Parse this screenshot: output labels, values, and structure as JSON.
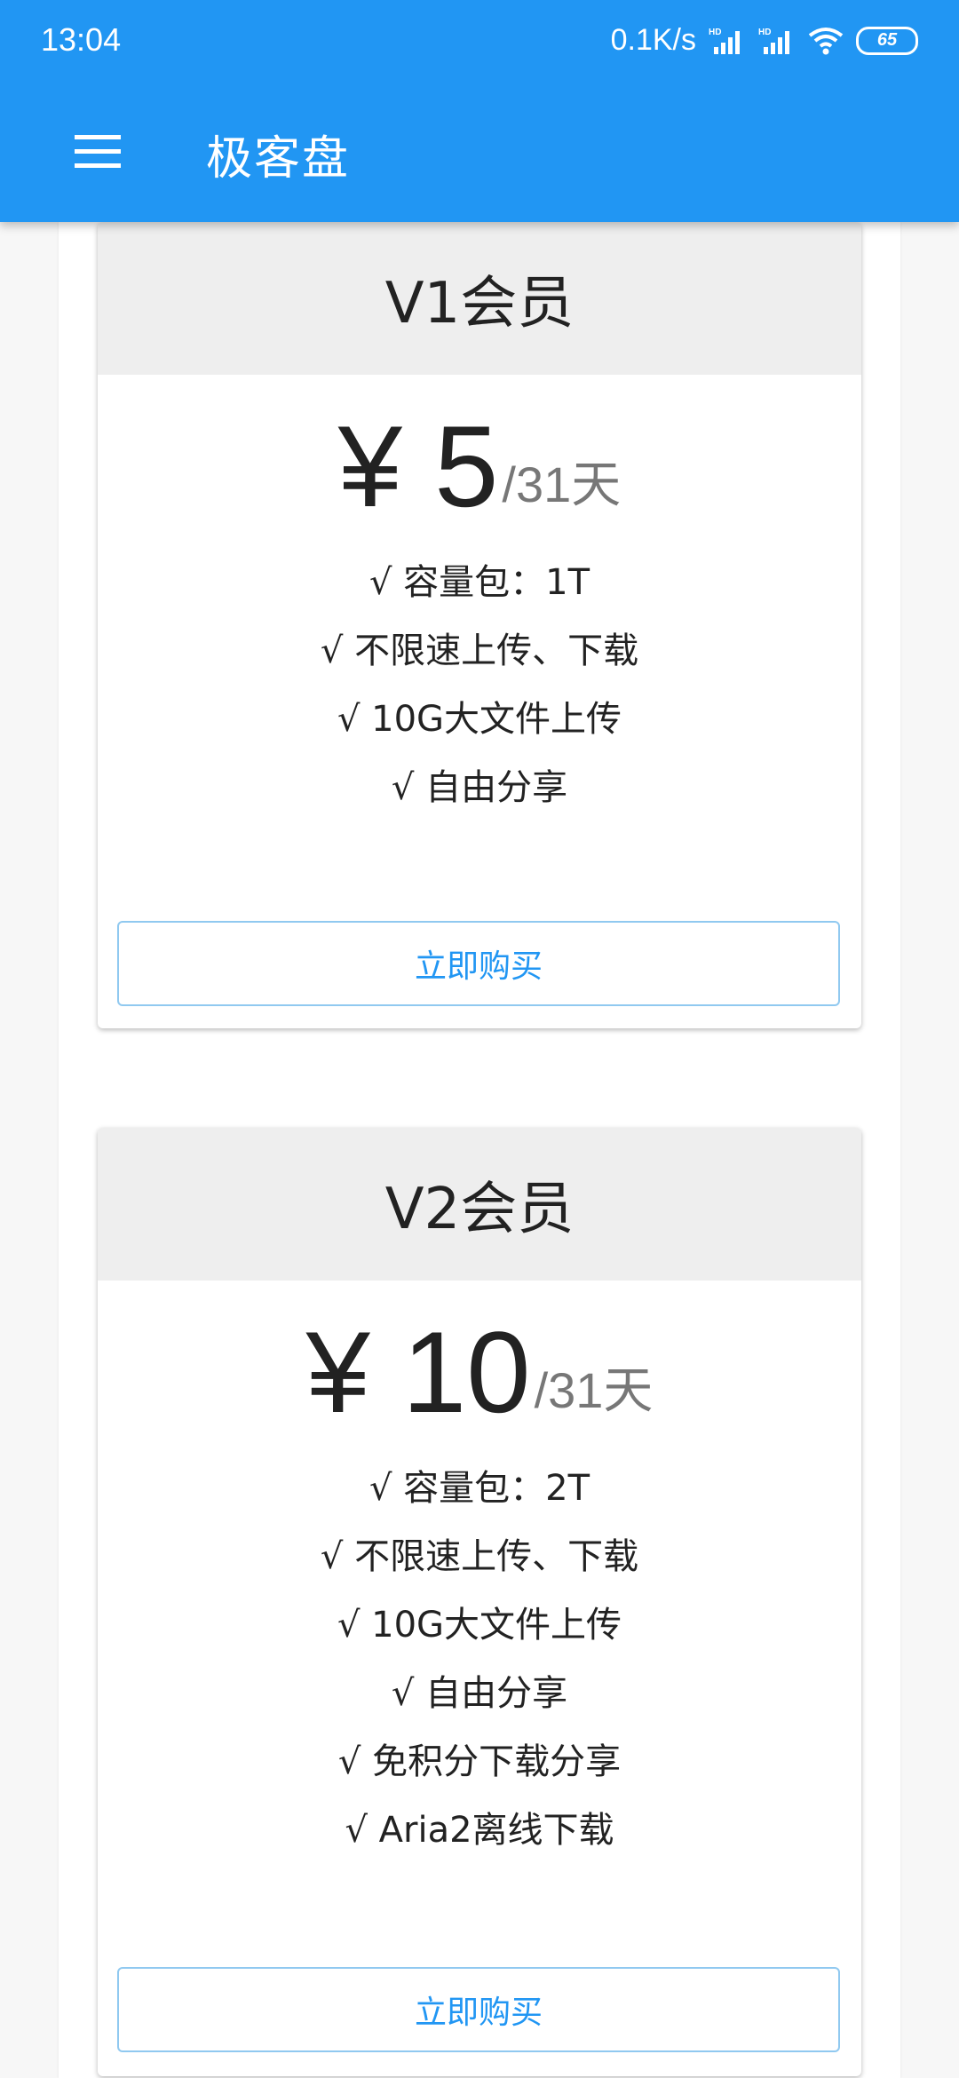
{
  "status_bar": {
    "time": "13:04",
    "net_speed": "0.1K/s",
    "battery": "65",
    "icons": [
      "hd-signal-icon",
      "hd-signal-icon",
      "wifi-icon",
      "battery-icon"
    ]
  },
  "toolbar": {
    "title": "极客盘",
    "menu_icon": "hamburger-menu-icon"
  },
  "colors": {
    "app_bar": "#2196f3",
    "accent": "#2196f3",
    "card_header": "#eeeeee"
  },
  "plans": [
    {
      "name": "V1会员",
      "price": "¥ 5",
      "period": "/31天",
      "features": [
        "√ 容量包：1T",
        "√ 不限速上传、下载",
        "√ 10G大文件上传",
        "√ 自由分享"
      ],
      "button": "立即购买"
    },
    {
      "name": "V2会员",
      "price": "¥ 10",
      "period": "/31天",
      "features": [
        "√ 容量包：2T",
        "√ 不限速上传、下载",
        "√ 10G大文件上传",
        "√ 自由分享",
        "√ 免积分下载分享",
        "√ Aria2离线下载"
      ],
      "button": "立即购买"
    }
  ]
}
